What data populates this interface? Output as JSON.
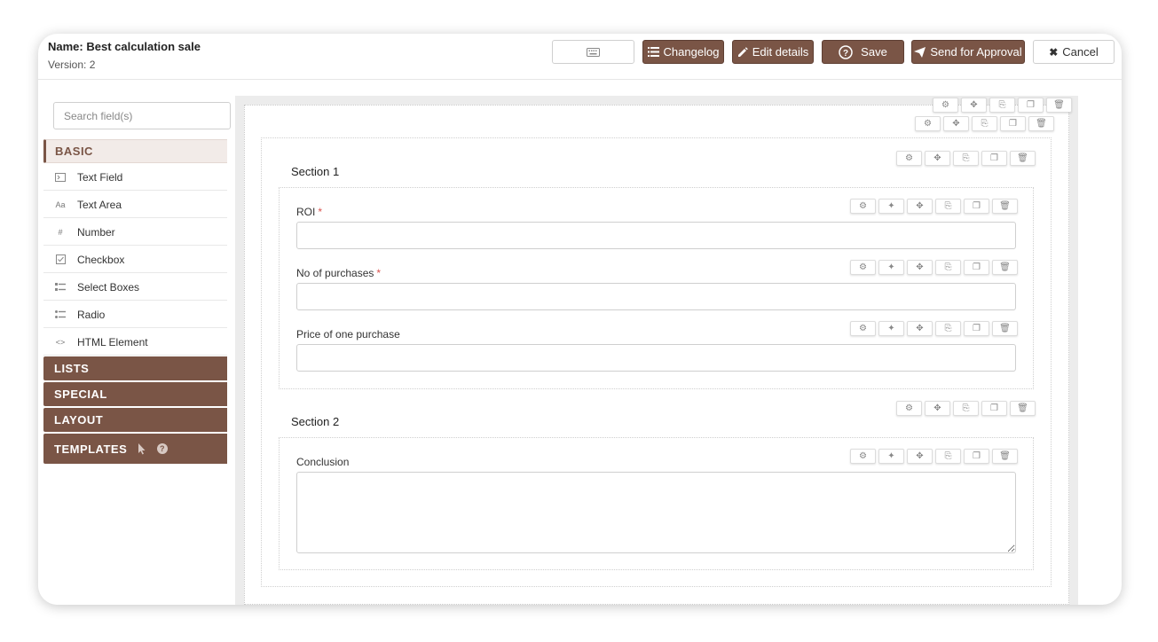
{
  "header": {
    "name_label": "Name: Best calculation sale",
    "version_label": "Version: 2",
    "buttons": {
      "changelog": "Changelog",
      "edit_details": "Edit details",
      "save": "Save",
      "send_for_approval": "Send for Approval",
      "cancel": "Cancel"
    }
  },
  "sidebar": {
    "search_placeholder": "Search field(s)",
    "groups": {
      "basic": "BASIC",
      "lists": "LISTS",
      "special": "SPECIAL",
      "layout": "LAYOUT",
      "templates": "TEMPLATES"
    },
    "basic_items": [
      {
        "label": "Text Field",
        "icon": "text-field-icon"
      },
      {
        "label": "Text Area",
        "icon": "text-area-icon",
        "glyph": "Aa"
      },
      {
        "label": "Number",
        "icon": "number-icon",
        "glyph": "#"
      },
      {
        "label": "Checkbox",
        "icon": "checkbox-icon"
      },
      {
        "label": "Select Boxes",
        "icon": "select-boxes-icon"
      },
      {
        "label": "Radio",
        "icon": "radio-icon"
      },
      {
        "label": "HTML Element",
        "icon": "html-element-icon",
        "glyph": "<>"
      }
    ]
  },
  "form": {
    "sections": [
      {
        "title": "Section 1",
        "fields": [
          {
            "label": "ROI",
            "required": "*",
            "value": ""
          },
          {
            "label": "No of purchases",
            "required": "*",
            "value": ""
          },
          {
            "label": "Price of one purchase",
            "value": ""
          }
        ]
      },
      {
        "title": "Section 2",
        "fields": [
          {
            "label": "Conclusion",
            "value": ""
          }
        ]
      }
    ]
  },
  "colors": {
    "accent": "#7a5546",
    "required": "#d9534f"
  }
}
